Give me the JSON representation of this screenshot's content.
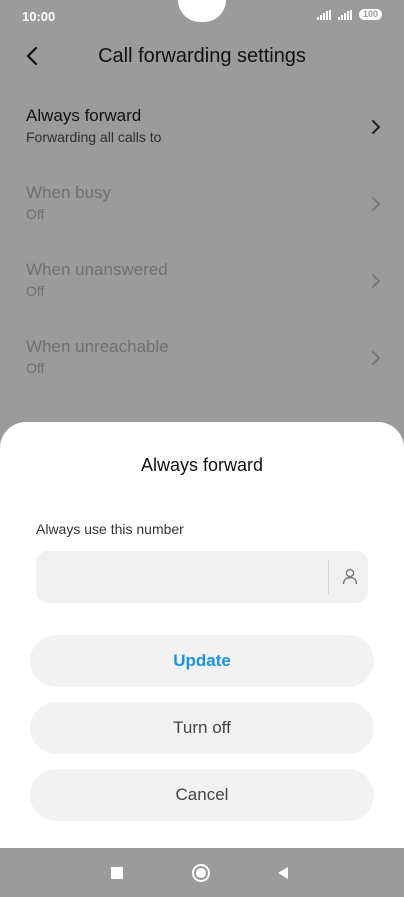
{
  "status_bar": {
    "time": "10:00",
    "battery": "100"
  },
  "header": {
    "title": "Call forwarding settings"
  },
  "list": {
    "items": [
      {
        "label": "Always forward",
        "sub": "Forwarding all calls to"
      },
      {
        "label": "When busy",
        "sub": "Off"
      },
      {
        "label": "When unanswered",
        "sub": "Off"
      },
      {
        "label": "When unreachable",
        "sub": "Off"
      }
    ]
  },
  "dialog": {
    "title": "Always forward",
    "field_label": "Always use this number",
    "number_value": "",
    "update_label": "Update",
    "turn_off_label": "Turn off",
    "cancel_label": "Cancel"
  },
  "colors": {
    "accent": "#1a93e0",
    "scrim": "#9b9b9b"
  }
}
